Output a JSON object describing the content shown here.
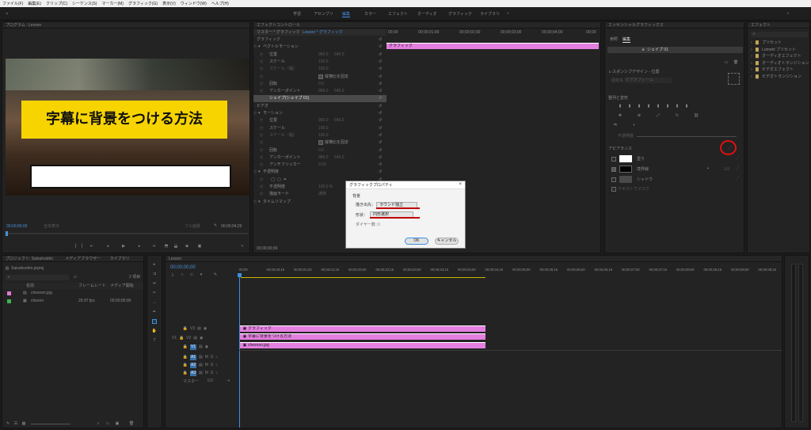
{
  "menubar": [
    "ファイル(F)",
    "編集(E)",
    "クリップ(C)",
    "シーケンス(S)",
    "マーカー(M)",
    "グラフィック(G)",
    "表示(V)",
    "ウィンドウ(W)",
    "ヘルプ(H)"
  ],
  "workspace_tabs": [
    {
      "label": "学習"
    },
    {
      "label": "アセンブリ"
    },
    {
      "label": "編集",
      "active": true
    },
    {
      "label": "カラー"
    },
    {
      "label": "エフェクト"
    },
    {
      "label": "オーディオ"
    },
    {
      "label": "グラフィック"
    },
    {
      "label": "ライブラリ"
    }
  ],
  "program": {
    "title": "プログラム : Lesson",
    "caption": "字幕に背景をつける方法",
    "timecode_left": "00;00;00;00",
    "fit": "全体表示",
    "quality": "フル画質",
    "timecode_right": "00;00;04;29"
  },
  "effect_controls": {
    "tab": "エフェクトコントロール",
    "master": "マスター * グラフィック",
    "sequence": "Lesson * グラフィック",
    "clip_label": "グラフィック",
    "rows": [
      {
        "label": "グラフィック",
        "type": "section"
      },
      {
        "label": "ベクトルモーション",
        "type": "group"
      },
      {
        "label": "位置",
        "v1": "960.0",
        "v2": "540.0"
      },
      {
        "label": "スケール",
        "v1": "100.0"
      },
      {
        "label": "スケール（幅）",
        "v1": "100.0",
        "dim": true
      },
      {
        "label": "縦横比を固定",
        "type": "check"
      },
      {
        "label": "回転",
        "v1": "0.0"
      },
      {
        "label": "アンカーポイント",
        "v1": "960.0",
        "v2": "540.0"
      },
      {
        "label": "シェイプ(シェイプ 01)",
        "type": "highlight"
      },
      {
        "label": "ビデオ",
        "type": "section"
      },
      {
        "label": "モーション",
        "type": "group"
      },
      {
        "label": "位置",
        "v1": "960.0",
        "v2": "540.0"
      },
      {
        "label": "スケール",
        "v1": "100.0"
      },
      {
        "label": "スケール（幅）",
        "v1": "100.0",
        "dim": true
      },
      {
        "label": "縦横比を固定",
        "type": "check"
      },
      {
        "label": "回転",
        "v1": "0.0"
      },
      {
        "label": "アンカーポイント",
        "v1": "960.0",
        "v2": "540.0"
      },
      {
        "label": "アンチフリッカー",
        "v1": "0.00"
      },
      {
        "label": "不透明度",
        "type": "group"
      },
      {
        "label": "",
        "type": "shapes"
      },
      {
        "label": "不透明度",
        "v1": "100.0 %"
      },
      {
        "label": "描画モード",
        "v1": "通常"
      },
      {
        "label": "タイムリマップ",
        "type": "group"
      }
    ],
    "ruler": [
      "00;00",
      "00;00;01;00",
      "00;00;02;00",
      "00;00;03;00",
      "00;00;04;00",
      "00;00"
    ],
    "footer_time": "00;00;00;00"
  },
  "essential_graphics": {
    "title": "エッセンシャルグラフィックス",
    "tabs": [
      "参照",
      "編集"
    ],
    "layer": "シェイプ 01",
    "responsive": "レスポンシブデザイン - 位置",
    "pin_label": "固定先：",
    "pin_value": "ビデオフレーム",
    "align_label": "整列と変形",
    "opacity_label": "不透明度",
    "appearance_label": "アピアランス",
    "fill": "塗り",
    "stroke": "境界線",
    "stroke_value": "1.0",
    "shadow": "シャドウ",
    "mask": "テキストでマスク",
    "fill_color": "#ffffff",
    "stroke_color": "#000000",
    "shadow_color": "#4a4a4a"
  },
  "effects_panel": {
    "title": "エフェクト",
    "items": [
      "プリセット",
      "Lumetri プリセット",
      "オーディオエフェクト",
      "オーディオトランジション",
      "ビデオエフェクト",
      "ビデオトランジション"
    ]
  },
  "dialog": {
    "title": "グラフィックプロパティ",
    "section": "背景",
    "row1_label": "描き出先：",
    "row1_value": "ラウンド独立",
    "row2_label": "形状：",
    "row2_value": "円形選択",
    "row3_label": "ダイヤー数：",
    "row3_value": "0",
    "ok": "OK",
    "cancel": "キャンセル"
  },
  "project": {
    "title": "プロジェクト: Saisuhoshin",
    "tab2": "メディアブラウザー",
    "tab3": "ライブラリ",
    "file": "Saisuhoshin.prproj",
    "count": "2 項目",
    "col_name": "名前",
    "col_rate": "フレームレート",
    "col_start": "メディア開始",
    "items": [
      {
        "name": "chesnon.jpg",
        "rate": "",
        "start": "",
        "color": "#e07ad0"
      },
      {
        "name": "chesnn",
        "rate": "29.97 fps",
        "start": "00;00;00;00",
        "color": "#3fb24e"
      }
    ]
  },
  "timeline": {
    "title": "Lesson",
    "timecode": "00;00;00;00",
    "ruler": [
      "00;00",
      "00;00;00;15",
      "00;00;01;00",
      "00;00;01;15",
      "00;00;02;00",
      "00;00;02;15",
      "00;00;03;00",
      "00;00;03;15",
      "00;00;04;00",
      "00;00;04;15",
      "00;00;05;00",
      "00;00;05;15",
      "00;00;06;00",
      "00;00;06;15",
      "00;00;07;00",
      "00;00;07;15",
      "00;00;08;00",
      "00;00;08;15",
      "00;00;09;00",
      "00;00;09;15"
    ],
    "video_tracks": [
      "V3",
      "V2",
      "V1"
    ],
    "audio_tracks": [
      "A1",
      "A2",
      "A3"
    ],
    "master": "マスター",
    "master_val": "0.0",
    "clips": [
      {
        "label": "グラフィック",
        "icon": "fx"
      },
      {
        "label": "字幕に背景をつける方法",
        "icon": "fx"
      },
      {
        "label": "chesnon.jpg",
        "icon": "fx"
      }
    ]
  }
}
